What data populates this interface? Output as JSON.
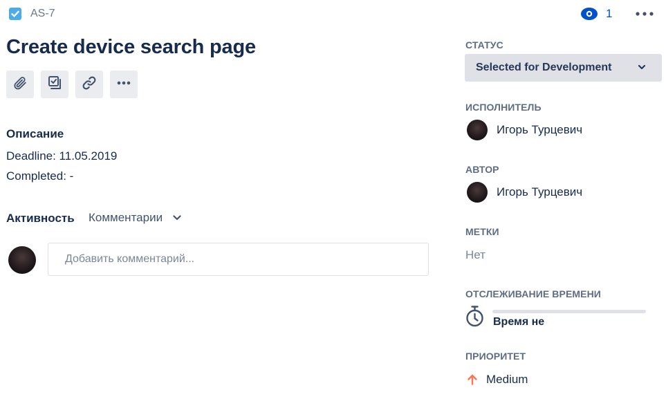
{
  "header": {
    "issue_key": "AS-7",
    "issue_type_icon": "checkbox-task-icon",
    "watchers_count": "1",
    "watch_icon": "eye-icon",
    "more_icon": "more-horizontal-icon"
  },
  "issue": {
    "title": "Create device search page"
  },
  "toolbar": {
    "items": [
      {
        "name": "attach-button",
        "icon": "paperclip-icon"
      },
      {
        "name": "create-subtask-button",
        "icon": "subtask-icon"
      },
      {
        "name": "link-issue-button",
        "icon": "link-icon"
      },
      {
        "name": "more-actions-button",
        "icon": "more-horizontal-icon"
      }
    ]
  },
  "description": {
    "heading": "Описание",
    "lines": [
      "Deadline: 11.05.2019",
      "Completed: -"
    ]
  },
  "activity": {
    "label": "Активность",
    "filter": "Комментарии",
    "comment_placeholder": "Добавить комментарий..."
  },
  "fields": {
    "status": {
      "label": "СТАТУС",
      "value": "Selected for Development"
    },
    "assignee": {
      "label": "ИСПОЛНИТЕЛЬ",
      "name": "Игорь Турцевич"
    },
    "reporter": {
      "label": "АВТОР",
      "name": "Игорь Турцевич"
    },
    "labels": {
      "label": "МЕТКИ",
      "value": "Нет"
    },
    "time_tracking": {
      "label": "ОТСЛЕЖИВАНИЕ ВРЕМЕНИ",
      "value": "Время не",
      "logged_fraction": 0
    },
    "priority": {
      "label": "ПРИОРИТЕТ",
      "value": "Medium",
      "icon": "arrow-up-icon"
    }
  },
  "colors": {
    "accent": "#0052cc",
    "text": "#172b4d",
    "muted": "#6b778c",
    "button_bg": "#ebecf0",
    "task_blue": "#4bade8",
    "priority_orange": "#ff7452"
  }
}
